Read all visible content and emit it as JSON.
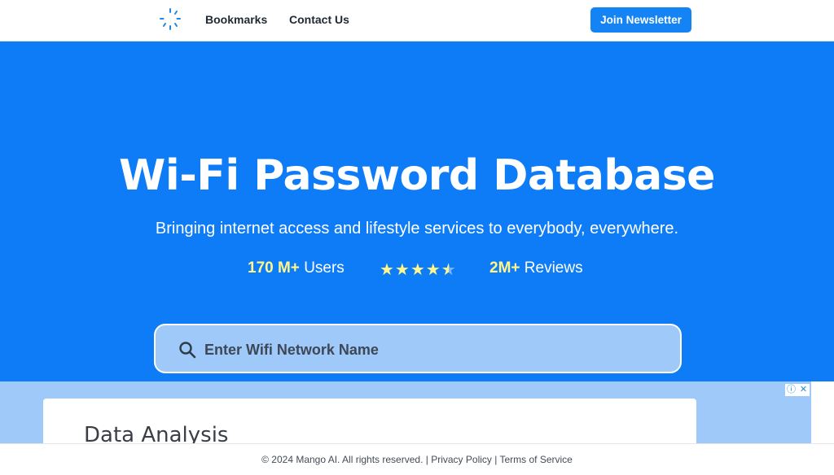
{
  "nav": {
    "logo_icon": "spinner-logo-icon",
    "links": [
      "Bookmarks",
      "Contact Us"
    ],
    "newsletter_label": "Join Newsletter"
  },
  "hero": {
    "title": "Wi-Fi Password Database",
    "subtitle": "Bringing internet access and lifestyle services to everybody, everywhere.",
    "users_count": "170 M+",
    "users_label": "Users",
    "rating": 4.5,
    "stars_full": "★★★★",
    "reviews_count": "2M+",
    "reviews_label": "Reviews",
    "search_placeholder": "Enter Wifi Network Name",
    "search_icon": "search-icon"
  },
  "ad": {
    "heading": "Data Analysis",
    "info_glyph": "ⓘ",
    "close_glyph": "✕"
  },
  "footer": {
    "copyright": "© 2024 Mango AI. All rights reserved.",
    "separator": "|",
    "privacy": "Privacy Policy",
    "terms": "Terms of Service"
  },
  "colors": {
    "hero_bg": "#0f7cf7",
    "accent_button": "#1483f4",
    "highlight_yellow": "#fff78a",
    "search_bg": "#9ec9f9"
  }
}
